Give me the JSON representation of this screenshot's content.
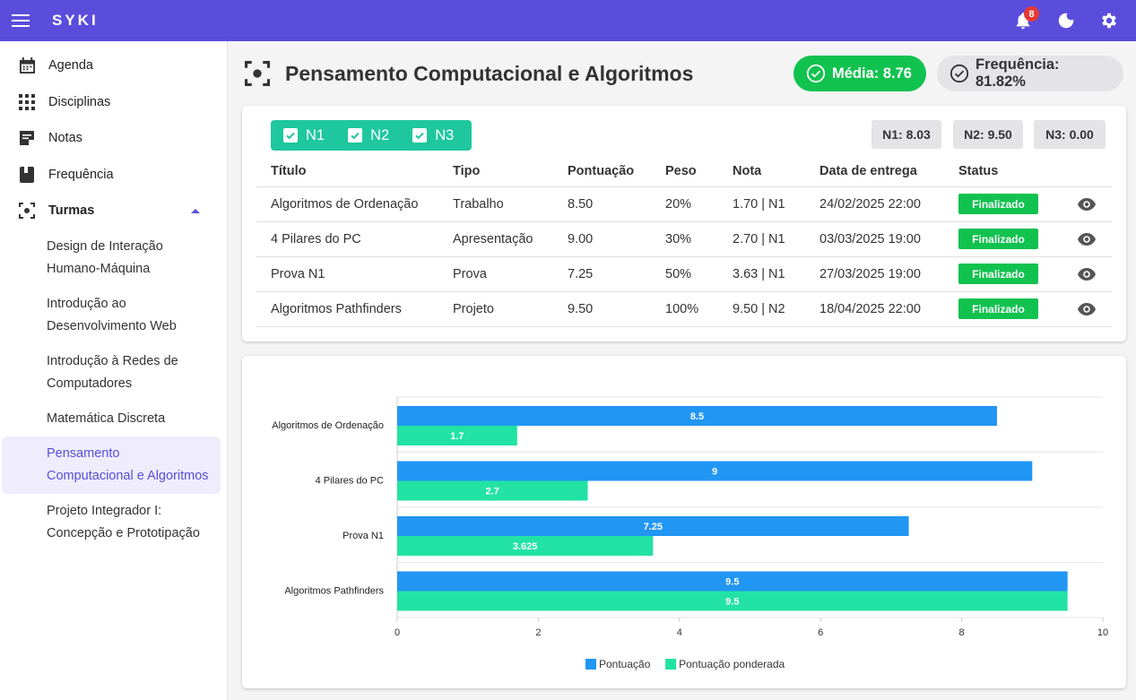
{
  "app": {
    "brand": "SYKI",
    "notification_count": "8"
  },
  "colors": {
    "primary": "#5b4ddb",
    "success": "#12c24f",
    "teal": "#1fc79e",
    "bar_score": "#2196f3",
    "bar_weighted": "#22e3a4"
  },
  "sidebar": {
    "items": [
      {
        "label": "Agenda",
        "icon": "calendar-icon"
      },
      {
        "label": "Disciplinas",
        "icon": "grid-icon"
      },
      {
        "label": "Notas",
        "icon": "notes-icon"
      },
      {
        "label": "Frequência",
        "icon": "book-icon"
      },
      {
        "label": "Turmas",
        "icon": "focus-icon"
      }
    ],
    "turmas": [
      "Design de Interação Humano-Máquina",
      "Introdução ao Desenvolvimento Web",
      "Introdução à Redes de Computadores",
      "Matemática Discreta",
      "Pensamento Computacional e Algoritmos",
      "Projeto Integrador I: Concepção e Prototipação"
    ]
  },
  "header": {
    "title": "Pensamento Computacional e Algoritmos",
    "media": "Média: 8.76",
    "frequencia": "Frequência: 81.82%"
  },
  "filters": [
    "N1",
    "N2",
    "N3"
  ],
  "notas": {
    "n1": "N1: 8.03",
    "n2": "N2: 9.50",
    "n3": "N3: 0.00"
  },
  "table": {
    "headers": [
      "Título",
      "Tipo",
      "Pontuação",
      "Peso",
      "Nota",
      "Data de entrega",
      "Status"
    ],
    "rows": [
      [
        "Algoritmos de Ordenação",
        "Trabalho",
        "8.50",
        "20%",
        "1.70 | N1",
        "24/02/2025 22:00",
        "Finalizado"
      ],
      [
        "4 Pilares do PC",
        "Apresentação",
        "9.00",
        "30%",
        "2.70 | N1",
        "03/03/2025 19:00",
        "Finalizado"
      ],
      [
        "Prova N1",
        "Prova",
        "7.25",
        "50%",
        "3.63 | N1",
        "27/03/2025 19:00",
        "Finalizado"
      ],
      [
        "Algoritmos Pathfinders",
        "Projeto",
        "9.50",
        "100%",
        "9.50 | N2",
        "18/04/2025 22:00",
        "Finalizado"
      ]
    ]
  },
  "chart_data": {
    "type": "bar",
    "orientation": "horizontal",
    "categories": [
      "Algoritmos de Ordenação",
      "4 Pilares do PC",
      "Prova N1",
      "Algoritmos Pathfinders"
    ],
    "series": [
      {
        "name": "Pontuação",
        "values": [
          8.5,
          9,
          7.25,
          9.5
        ],
        "labels": [
          "8.5",
          "9",
          "7.25",
          "9.5"
        ],
        "color": "#2196f3"
      },
      {
        "name": "Pontuação ponderada",
        "values": [
          1.7,
          2.7,
          3.625,
          9.5
        ],
        "labels": [
          "1.7",
          "2.7",
          "3.625",
          "9.5"
        ],
        "color": "#22e3a4"
      }
    ],
    "xlim": [
      0,
      10
    ],
    "xticks": [
      "0",
      "2",
      "4",
      "6",
      "8",
      "10"
    ],
    "grid": true,
    "legend": "bottom"
  }
}
